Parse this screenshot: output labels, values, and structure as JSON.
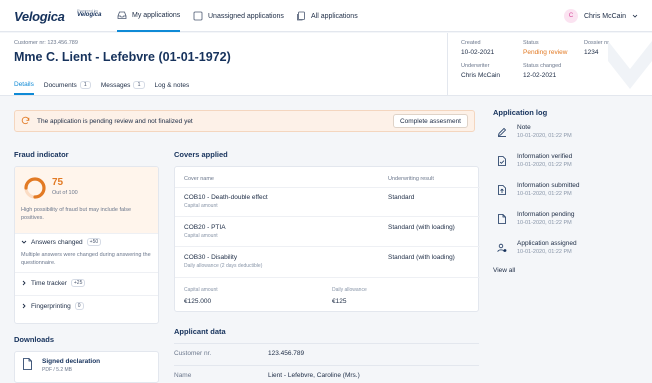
{
  "brand": {
    "logo": "Velogica",
    "powered_by": "Powered by",
    "powered_name": "Velogica"
  },
  "nav": {
    "tabs": [
      {
        "label": "My applications",
        "icon": "inbox-icon",
        "active": true
      },
      {
        "label": "Unassigned applications",
        "icon": "square-icon",
        "active": false
      },
      {
        "label": "All applications",
        "icon": "copy-icon",
        "active": false
      }
    ],
    "user": {
      "initial": "C",
      "name": "Chris McCain"
    }
  },
  "header": {
    "customer_nr": "Customer nr: 123.456.789",
    "client_title": "Mme C. Lient - Lefebvre (01-01-1972)",
    "tabs": [
      {
        "label": "Details",
        "count": null,
        "active": true
      },
      {
        "label": "Documents",
        "count": "1",
        "active": false
      },
      {
        "label": "Messages",
        "count": "1",
        "active": false
      },
      {
        "label": "Log & notes",
        "count": null,
        "active": false
      }
    ],
    "meta": {
      "created_label": "Created",
      "created": "10-02-2021",
      "status_label": "Status",
      "status": "Pending review",
      "dossier_label": "Dossier nr.",
      "dossier": "1234",
      "underwriter_label": "Underwriter",
      "underwriter": "Chris McCain",
      "status_changed_label": "Status changed",
      "status_changed": "12-02-2021"
    }
  },
  "alert": {
    "text": "The application is pending review and not finalized yet",
    "button": "Complete assesment"
  },
  "fraud": {
    "title": "Fraud indicator",
    "score": "75",
    "score_value": 0.75,
    "out_of": "Out of 100",
    "description": "High possibility of fraud but may include false positives.",
    "sections": [
      {
        "label": "Answers changed",
        "badge": "+50",
        "expanded": true,
        "description": "Multiple answers were changed during answering the questionnaire."
      },
      {
        "label": "Time tracker",
        "badge": "+25",
        "expanded": false
      },
      {
        "label": "Fingerprinting",
        "badge": "0",
        "expanded": false
      }
    ]
  },
  "downloads": {
    "title": "Downloads",
    "items": [
      {
        "name": "Signed declaration",
        "meta": "PDF / 5.2 MB"
      }
    ]
  },
  "covers": {
    "title": "Covers applied",
    "columns": [
      "Cover name",
      "Underwriting result"
    ],
    "rows": [
      {
        "name": "COB10 - Death-double effect",
        "sub": "Capital amount",
        "result": "Standard"
      },
      {
        "name": "COB20 - PTIA",
        "sub": "Capital amount",
        "result": "Standard (with loading)"
      },
      {
        "name": "COB30 - Disability",
        "sub": "Daily allowance (2 days deductible)",
        "result": "Standard (with loading)"
      }
    ],
    "totals": [
      {
        "label": "Capital amount",
        "value": "€125.000"
      },
      {
        "label": "Daily allowance",
        "value": "€125"
      }
    ]
  },
  "applicant": {
    "title": "Applicant data",
    "rows": [
      {
        "label": "Customer nr.",
        "value": "123.456.789"
      },
      {
        "label": "Name",
        "value": "Lient - Lefebvre, Caroline (Mrs.)"
      }
    ]
  },
  "log": {
    "title": "Application log",
    "items": [
      {
        "title": "Note",
        "time": "10-01-2020, 01:22 PM",
        "icon": "pencil-icon"
      },
      {
        "title": "Information verified",
        "time": "10-01-2020, 01:22 PM",
        "icon": "doc-check-icon"
      },
      {
        "title": "Information submitted",
        "time": "10-01-2020, 01:22 PM",
        "icon": "doc-upload-icon"
      },
      {
        "title": "Information pending",
        "time": "10-01-2020, 01:22 PM",
        "icon": "doc-icon"
      },
      {
        "title": "Application assigned",
        "time": "10-01-2020, 01:22 PM",
        "icon": "user-assign-icon"
      }
    ],
    "view_all": "View all"
  },
  "colors": {
    "accent": "#0f8ad6",
    "brand": "#16325c",
    "warning": "#e27a24",
    "alert_bg": "#fdf1e8"
  }
}
